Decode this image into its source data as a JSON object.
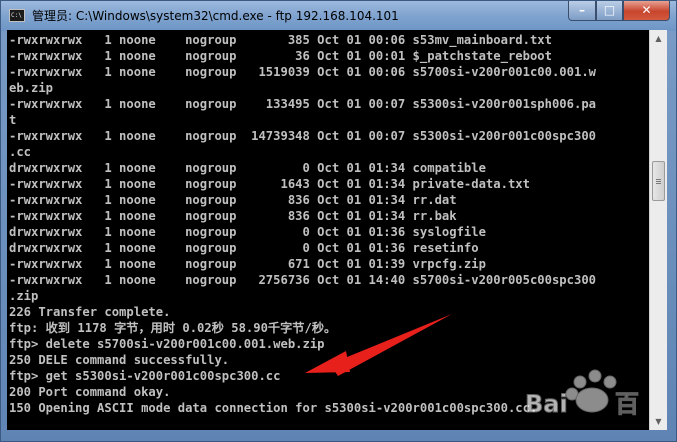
{
  "window": {
    "title": "管理员: C:\\Windows\\system32\\cmd.exe - ftp  192.168.104.101",
    "icon": "cmd-icon",
    "buttons": {
      "minimize": "–",
      "maximize": "□",
      "close": "✕"
    }
  },
  "console": {
    "lines": [
      "-rwxrwxrwx   1 noone    nogroup       385 Oct 01 00:06 s53mv_mainboard.txt",
      "-rwxrwxrwx   1 noone    nogroup        36 Oct 01 00:01 $_patchstate_reboot",
      "-rwxrwxrwx   1 noone    nogroup   1519039 Oct 01 00:06 s5700si-v200r001c00.001.w",
      "eb.zip",
      "-rwxrwxrwx   1 noone    nogroup    133495 Oct 01 00:07 s5300si-v200r001sph006.pa",
      "t",
      "-rwxrwxrwx   1 noone    nogroup  14739348 Oct 01 00:07 s5300si-v200r001c00spc300",
      ".cc",
      "drwxrwxrwx   1 noone    nogroup         0 Oct 01 01:34 compatible",
      "-rwxrwxrwx   1 noone    nogroup      1643 Oct 01 01:34 private-data.txt",
      "-rwxrwxrwx   1 noone    nogroup       836 Oct 01 01:34 rr.dat",
      "-rwxrwxrwx   1 noone    nogroup       836 Oct 01 01:34 rr.bak",
      "drwxrwxrwx   1 noone    nogroup         0 Oct 01 01:36 syslogfile",
      "drwxrwxrwx   1 noone    nogroup         0 Oct 01 01:36 resetinfo",
      "-rwxrwxrwx   1 noone    nogroup       671 Oct 01 01:39 vrpcfg.zip",
      "-rwxrwxrwx   1 noone    nogroup   2756736 Oct 01 14:40 s5700si-v200r005c00spc300",
      ".zip",
      "226 Transfer complete.",
      "ftp: 收到 1178 字节，用时 0.02秒 58.90千字节/秒。",
      "ftp> delete s5700si-v200r001c00.001.web.zip",
      "250 DELE command successfully.",
      "ftp> get s5300si-v200r001c00spc300.cc",
      "200 Port command okay.",
      "150 Opening ASCII mode data connection for s5300si-v200r001c00spc300.cc."
    ]
  },
  "scrollbar": {
    "up_icon": "▲",
    "down_icon": "▼",
    "position": 0.35
  },
  "colors": {
    "console_bg": "#000000",
    "console_text": "#c0c0c0",
    "annotation_arrow": "#e8201c"
  }
}
